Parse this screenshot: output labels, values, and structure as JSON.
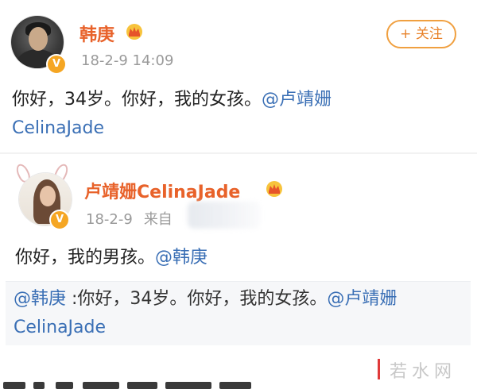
{
  "post1": {
    "author": "韩庚",
    "timestamp": "18-2-9 14:09",
    "follow_label": "+ 关注",
    "text_main": "你好，34岁。你好，我的女孩。",
    "mention": "@卢靖姗",
    "mention_cont": "CelinaJade"
  },
  "post2": {
    "author": "卢靖姗CelinaJade",
    "timestamp": "18-2-9",
    "source_prefix": "来自",
    "text_main": "你好，我的男孩。",
    "mention": "@韩庚"
  },
  "quote": {
    "mention": "@韩庚",
    "text": " :你好，34岁。你好，我的女孩。",
    "mention2": "@卢靖姗",
    "mention2_cont": "CelinaJade"
  },
  "verified_badge": "V",
  "icons": {
    "crown": "crown-icon",
    "verified": "verified-badge-icon"
  },
  "colors": {
    "username": "#e8622a",
    "mention": "#3a6fb5",
    "follow_border": "#f0a040",
    "timestamp": "#9a9a9a",
    "verified": "#f5a623"
  },
  "watermark": {
    "text": "若水网"
  }
}
